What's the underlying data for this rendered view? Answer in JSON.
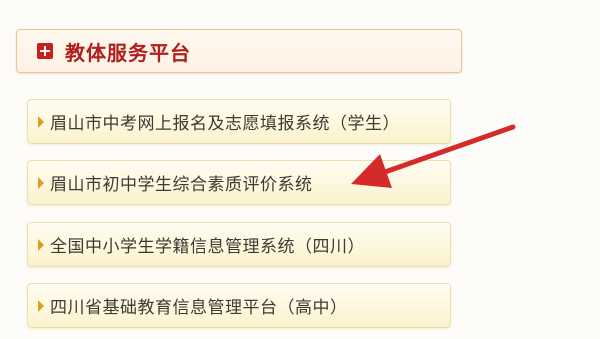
{
  "panel": {
    "title": "教体服务平台",
    "title_icon": "plus-icon",
    "accent_color": "#c8201f"
  },
  "items": [
    {
      "label": "眉山市中考网上报名及志愿填报系统（学生）"
    },
    {
      "label": "眉山市初中学生综合素质评价系统"
    },
    {
      "label": "全国中小学生学籍信息管理系统（四川）"
    },
    {
      "label": "四川省基础教育信息管理平台（高中）"
    }
  ],
  "annotation": {
    "icon": "red-arrow-icon",
    "color": "#d42a2a"
  }
}
